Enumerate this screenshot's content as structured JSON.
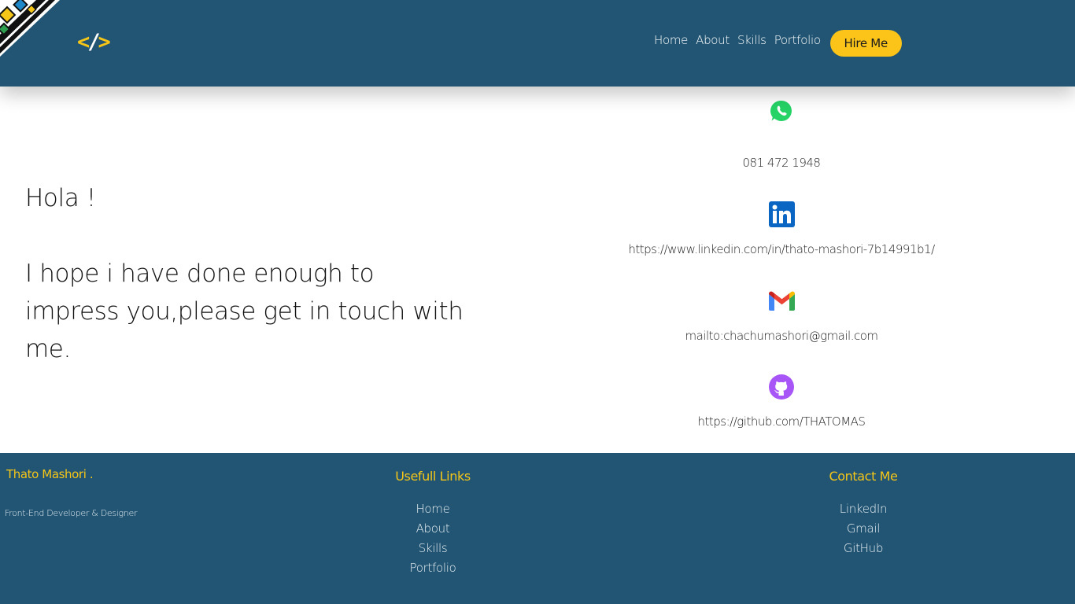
{
  "header": {
    "logo_left": "<",
    "logo_slash": "/",
    "logo_right": ">",
    "nav": [
      "Home",
      "About",
      "Skills",
      "Portfolio"
    ],
    "hire_label": "Hire Me",
    "colors": {
      "background": "#215573",
      "accent": "#fcc419"
    }
  },
  "hero": {
    "greeting": "Hola !",
    "line1": "I hope i have done enough to",
    "line2": "impress you,please get in touch with",
    "line3": "me."
  },
  "contacts": {
    "phone": {
      "icon": "whatsapp-icon",
      "text": "081 472 1948"
    },
    "linkedin": {
      "icon": "linkedin-icon",
      "text": "https://www.linkedin.com/in/thato-mashori-7b14991b1/"
    },
    "email": {
      "icon": "gmail-icon",
      "text": "mailto:chachumashori@gmail.com"
    },
    "github": {
      "icon": "github-icon",
      "text": "https://github.com/THATOMAS"
    }
  },
  "footer": {
    "name": "Thato Mashori .",
    "role": "Front-End Developer & Designer",
    "links_title": "Usefull Links",
    "links": [
      "Home",
      "About",
      "Skills",
      "Portfolio"
    ],
    "contact_title": "Contact Me",
    "contact_links": [
      "LinkedIn",
      "Gmail",
      "GitHub"
    ]
  }
}
